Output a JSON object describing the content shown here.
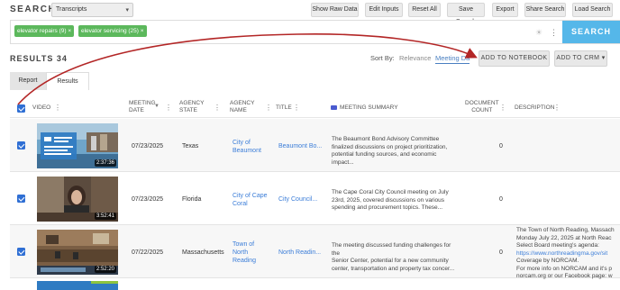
{
  "header": {
    "search_title": "SEARCH",
    "source_select": "Transcripts",
    "buttons": [
      "Show Raw Data",
      "Edit Inputs",
      "Reset All",
      "Save Search",
      "Export",
      "Share Search",
      "Load Search"
    ]
  },
  "query": {
    "chips": [
      "elevator repairs (9)",
      "elevator servicing (25)"
    ],
    "search_button": "SEARCH"
  },
  "results_bar": {
    "results_label": "RESULTS 34",
    "sort_by": "Sort By:",
    "sort_relevance": "Relevance",
    "sort_meeting_date": "Meeting Da",
    "add_to_notebook": "ADD TO NOTEBOOK",
    "add_to_crm": "ADD TO CRM"
  },
  "tabs": [
    "Report",
    "Results"
  ],
  "columns": {
    "video": "VIDEO",
    "meeting_date": [
      "MEETING",
      "DATE"
    ],
    "agency_state": [
      "AGENCY",
      "STATE"
    ],
    "agency_name": [
      "AGENCY",
      "NAME"
    ],
    "title": "TITLE",
    "meeting_summary": "MEETING SUMMARY",
    "document_count": [
      "DOCUMENT",
      "COUNT"
    ],
    "description": "DESCRIPTION"
  },
  "rows": [
    {
      "duration": "2:37:36",
      "date": "07/23/2025",
      "state": "Texas",
      "agency": [
        "City of",
        "Beaumont"
      ],
      "title": "Beaumont Bo...",
      "summary": [
        "The Beaumont Bond Advisory Committee",
        "finalized discussions on project prioritization,",
        "potential funding sources, and economic impact..."
      ],
      "doc_count": "0",
      "description": []
    },
    {
      "duration": "3:52:41",
      "date": "07/23/2025",
      "state": "Florida",
      "agency": [
        "City of Cape",
        "Coral"
      ],
      "title": "City Council...",
      "summary": [
        "The Cape Coral City Council meeting on July",
        "23rd, 2025, covered discussions on various",
        "spending and procurement topics. These..."
      ],
      "doc_count": "0",
      "description": []
    },
    {
      "duration": "2:52:20",
      "date": "07/22/2025",
      "state": "Massachusetts",
      "agency": [
        "Town of",
        "North",
        "Reading"
      ],
      "title": "North Readin...",
      "summary": [
        "The meeting discussed funding challenges for the",
        "Senior Center, potential for a new community",
        "center, transportation and property tax concer..."
      ],
      "doc_count": "0",
      "description": [
        {
          "text": "The Town of North Reading, Massach",
          "link": false
        },
        {
          "text": "Monday July 22, 2025 at North Reac",
          "link": false
        },
        {
          "text": "Select Board meeting's agenda:",
          "link": false
        },
        {
          "text": "https://www.northreadingma.gov/sit",
          "link": true
        },
        {
          "text": "Coverage by NORCAM.",
          "link": false
        },
        {
          "text": "For more info on NORCAM and it's p",
          "link": false
        },
        {
          "text": "norcam.org or our Facebook page: w",
          "link": false
        }
      ]
    }
  ],
  "colors": {
    "accent_blue": "#3b7dd8",
    "chip_green": "#5cb85c",
    "search_button": "#55b7e9",
    "annotation_arrow": "#b32626"
  }
}
